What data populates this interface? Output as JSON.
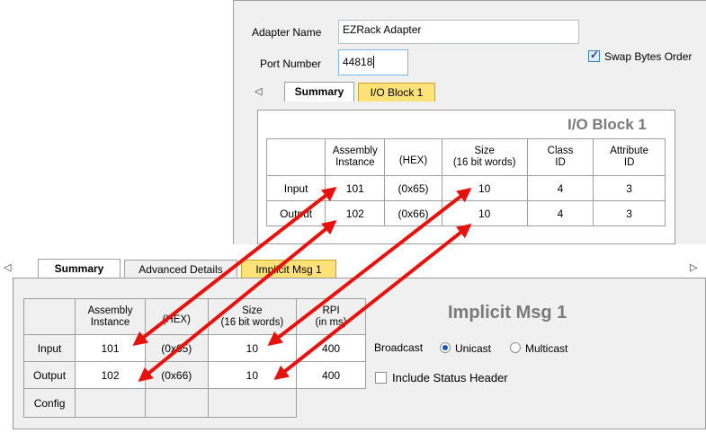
{
  "adapter": {
    "name_label": "Adapter Name",
    "name_value": "EZRack Adapter",
    "port_label": "Port Number",
    "port_value": "44818",
    "swap_label": "Swap Bytes Order",
    "swap_checked": true
  },
  "top_tabs": {
    "scroll_left": "◁",
    "tabs": [
      "Summary",
      "I/O Block 1"
    ]
  },
  "io_block": {
    "title": "I/O Block 1",
    "headers": [
      "Assembly Instance",
      "(HEX)",
      "Size (16 bit words)",
      "Class ID",
      "Attribute ID"
    ],
    "header_lines": [
      [
        "Assembly",
        "Instance"
      ],
      [
        "(HEX)"
      ],
      [
        "Size",
        "(16 bit words)"
      ],
      [
        "Class",
        "ID"
      ],
      [
        "Attribute",
        "ID"
      ]
    ],
    "rows": [
      {
        "label": "Input",
        "instance": "101",
        "hex": "(0x65)",
        "size": "10",
        "class_id": "4",
        "attribute_id": "3"
      },
      {
        "label": "Output",
        "instance": "102",
        "hex": "(0x66)",
        "size": "10",
        "class_id": "4",
        "attribute_id": "3"
      }
    ]
  },
  "bottom_tabs": {
    "scroll_left": "◁",
    "scroll_right": "▷",
    "tabs": [
      "Summary",
      "Advanced Details",
      "Implicit Msg 1"
    ]
  },
  "implicit": {
    "title": "Implicit Msg 1",
    "header_lines": [
      [
        "Assembly",
        "Instance"
      ],
      [
        "(HEX)"
      ],
      [
        "Size",
        "(16 bit words)"
      ],
      [
        "RPI",
        "(in ms)"
      ]
    ],
    "rows": [
      {
        "label": "Input",
        "instance": "101",
        "hex": "(0x65)",
        "size": "10",
        "rpi": "400"
      },
      {
        "label": "Output",
        "instance": "102",
        "hex": "(0x66)",
        "size": "10",
        "rpi": "400"
      },
      {
        "label": "Config",
        "instance": "",
        "hex": "",
        "size": "",
        "rpi": ""
      }
    ],
    "broadcast_label": "Broadcast",
    "unicast_label": "Unicast",
    "multicast_label": "Multicast",
    "unicast_selected": true,
    "status_header_label": "Include Status Header",
    "status_header_checked": false
  },
  "colors": {
    "arrow": "#e8120c",
    "tab_active_yellow": "#fde27a",
    "title_gray": "#7a7a7a"
  }
}
